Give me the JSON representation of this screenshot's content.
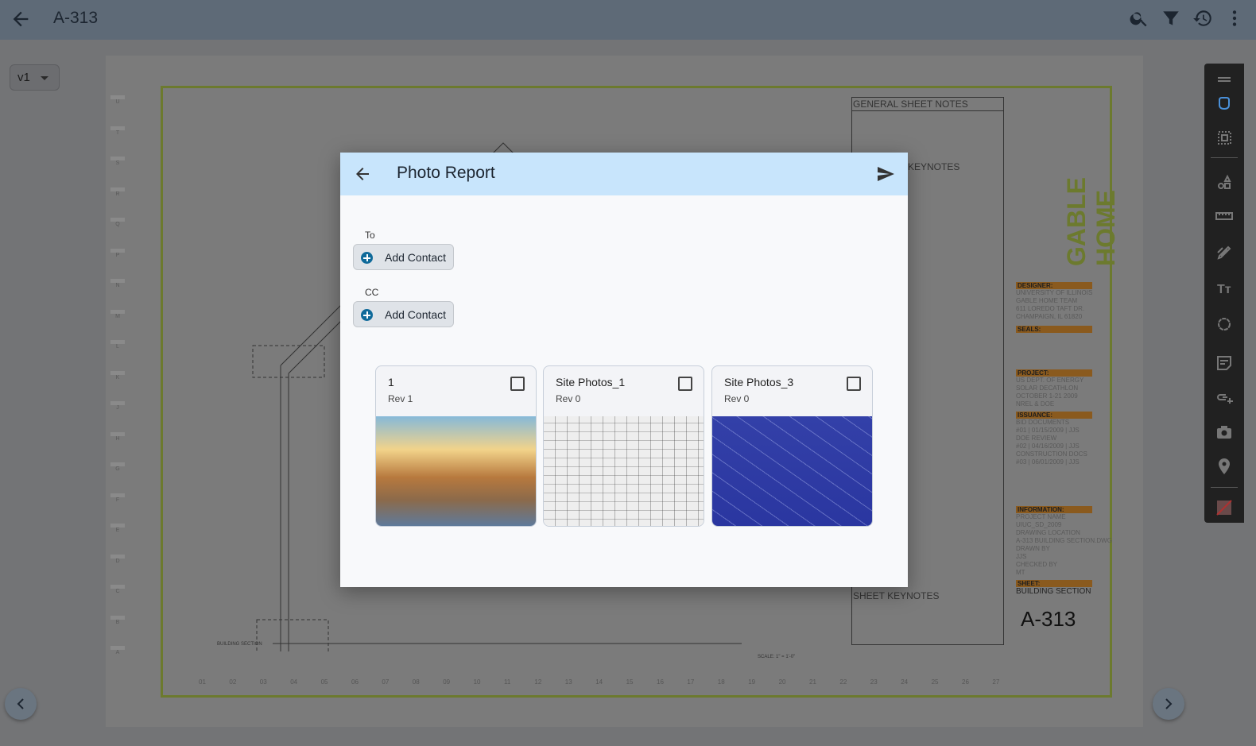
{
  "topbar": {
    "title": "A-313",
    "icons": [
      "arrow-left-icon",
      "search-icon",
      "filter-icon",
      "history-icon",
      "more-vert-icon"
    ]
  },
  "version_select": {
    "value": "v1"
  },
  "drawing": {
    "row_letters": [
      "U",
      "T",
      "S",
      "R",
      "Q",
      "P",
      "N",
      "M",
      "L",
      "K",
      "J",
      "H",
      "G",
      "F",
      "E",
      "D",
      "C",
      "B",
      "A"
    ],
    "col_numbers": [
      "01",
      "02",
      "03",
      "04",
      "05",
      "06",
      "07",
      "08",
      "09",
      "10",
      "11",
      "12",
      "13",
      "14",
      "15",
      "16",
      "17",
      "18",
      "19",
      "20",
      "21",
      "22",
      "23",
      "24",
      "25",
      "26",
      "27"
    ],
    "general_notes": "GENERAL SHEET NOTES",
    "keynotes": "KEYNOTES",
    "sheet_keynotes": "SHEET KEYNOTES",
    "logo": "GABLE HOME",
    "section_label": "BUILDING SECTION",
    "scale": "SCALE: 1\" = 1'-0\"",
    "designer_h": "DESIGNER:",
    "designer": [
      "UNIVERSITY OF ILLINOIS",
      "GABLE HOME TEAM",
      "611 LOREDO TAFT DR.",
      "CHAMPAIGN, IL 61820"
    ],
    "seals_h": "SEALS:",
    "project_h": "PROJECT:",
    "project": [
      "US DEPT. OF ENERGY",
      "SOLAR DECATHLON",
      "OCTOBER 1-21 2009",
      "NREL & DOE"
    ],
    "issuance_h": "ISSUANCE:",
    "issuance": [
      "BID DOCUMENTS",
      "#01 | 01/15/2009 | JJS",
      "DOE REVIEW",
      "#02 | 04/16/2009 | JJS",
      "CONSTRUCTION DOCS",
      "#03 | 06/01/2009 | JJS"
    ],
    "information_h": "INFORMATION:",
    "information": [
      "PROJECT NAME",
      "UIUC_SD_2009",
      "DRAWING LOCATION",
      "A-313 BUILDING SECTION.DWG",
      "DRAWN BY",
      "JJS",
      "CHECKED BY",
      "MT"
    ],
    "sheet_h": "SHEET:",
    "sheet_name": "BUILDING SECTION",
    "sheet_number": "A-313"
  },
  "toolbar": {
    "tools": [
      "drag-handle-icon",
      "pan-hand-icon",
      "select-area-icon",
      "shapes-icon",
      "ruler-icon",
      "pen-icon",
      "text-icon",
      "cloud-icon",
      "note-icon",
      "link-add-icon",
      "camera-icon",
      "pin-icon",
      "color-swatch-icon"
    ],
    "active": "pan-hand-icon",
    "accent": "#4a90d9"
  },
  "dialog": {
    "title": "Photo Report",
    "to_label": "To",
    "cc_label": "CC",
    "add_contact": "Add Contact",
    "header_color": "#c8e5fc",
    "cards": [
      {
        "title": "1",
        "rev": "Rev 1",
        "checked": false
      },
      {
        "title": "Site Photos_1",
        "rev": "Rev 0",
        "checked": false
      },
      {
        "title": "Site Photos_3",
        "rev": "Rev 0",
        "checked": false
      }
    ]
  }
}
